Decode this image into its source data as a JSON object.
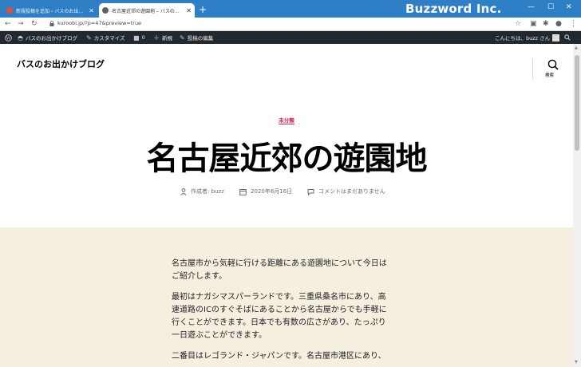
{
  "browser": {
    "tabs": [
      {
        "title": "新規投稿を追加 ‹ バスのお出かけブログ",
        "active": false
      },
      {
        "title": "名古屋近郊の遊園地 – バスのお出かけブ",
        "active": true
      }
    ],
    "new_tab": "+",
    "brand": "Buzzword Inc.",
    "url": "kuroobi.jp/?p=47&preview=true"
  },
  "adminbar": {
    "site_name": "バスのお出かけブログ",
    "customize": "カスタマイズ",
    "comments_count": "0",
    "new": "新規",
    "edit_post": "投稿の編集",
    "greeting": "こんにちは、buzz さん"
  },
  "header": {
    "site_title": "バスのお出かけブログ",
    "search_label": "検索"
  },
  "post": {
    "category": "未分類",
    "title": "名古屋近郊の遊園地",
    "author": "作成者: buzz",
    "date": "2020年6月16日",
    "comments": "コメントはまだありません",
    "paragraphs": [
      [
        "名古屋市から気軽に行ける距離にある遊園地について今日は",
        "ご紹介します。"
      ],
      [
        "最初はナガシマスパーランドです。三重県桑名市にあり、高",
        "速道路のICのすぐそばにあることから名古屋からでも手軽に",
        "行くことができます。日本でも有数の広さがあり、たっぷり",
        "一日遊ぶことができます。"
      ],
      [
        "二番目はレゴランド・ジャパンです。名古屋市港区にあり、"
      ]
    ]
  },
  "colors": {
    "titlebar": "#2f7fc6",
    "adminbar": "#23282d",
    "accent": "#cd2653",
    "content_bg": "#f5efe0"
  }
}
